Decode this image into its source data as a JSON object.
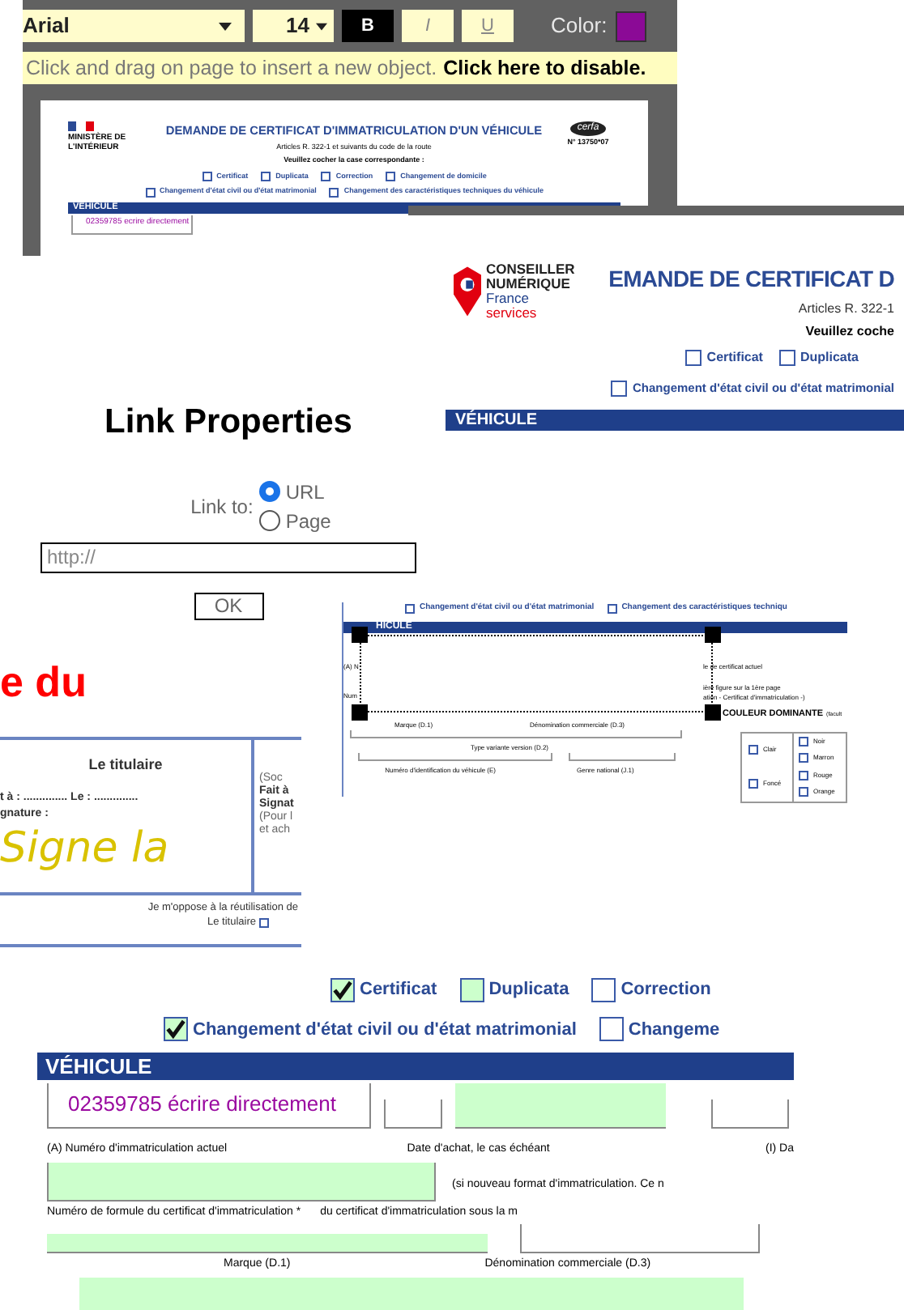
{
  "toolbar": {
    "font": "Arial",
    "size": "14",
    "styles": [
      {
        "label": "B",
        "kind": "bold",
        "selected": true
      },
      {
        "label": "I",
        "kind": "italic",
        "selected": false
      },
      {
        "label": "U",
        "kind": "underline",
        "selected": false
      }
    ],
    "color_label": "Color:",
    "color": "#8b0a96"
  },
  "hint": {
    "text": "Click and drag on page to insert a new object.",
    "link": "Click here to disable."
  },
  "preview_1": {
    "ministry": "MINISTÈRE DE L'INTÉRIEUR",
    "title": "DEMANDE DE CERTIFICAT D'IMMATRICULATION D'UN VÉHICULE",
    "cerfa": "cerfa",
    "cerfa_number": "N° 13750*07",
    "articles": "Articles R. 322-1 et suivants du code de la route",
    "instruction": "Veuillez cocher la case correspondante :",
    "options_row_1": [
      {
        "label": "Certificat",
        "checked": false
      },
      {
        "label": "Duplicata",
        "checked": false
      },
      {
        "label": "Correction",
        "checked": false
      },
      {
        "label": "Changement de domicile",
        "checked": false
      }
    ],
    "options_row_2": [
      {
        "label": "Changement d'état civil ou d'état matrimonial",
        "checked": false
      },
      {
        "label": "Changement des caractéristiques techniques du véhicule",
        "checked": false
      }
    ],
    "section": "VÉHICULE",
    "typed": "02359785 ecrire directement"
  },
  "preview_2": {
    "logo": [
      "CONSEILLER",
      "NUMÉRIQUE",
      "France",
      "services"
    ],
    "title": "EMANDE DE CERTIFICAT D",
    "articles": "Articles R. 322-1",
    "instruction": "Veuillez coche",
    "options_row_1": [
      {
        "label": "Certificat",
        "checked": false
      },
      {
        "label": "Duplicata",
        "checked": false
      }
    ],
    "options_row_2": [
      {
        "label": "Changement d'état civil ou d'état matrimonial",
        "checked": false
      }
    ],
    "section": "VÉHICULE"
  },
  "link_dialog": {
    "title": "Link Properties",
    "label": "Link to:",
    "options": [
      {
        "label": "URL",
        "selected": true
      },
      {
        "label": "Page",
        "selected": false
      }
    ],
    "placeholder": "http://",
    "ok": "OK"
  },
  "red_fragment": "e du",
  "signature": {
    "heading": "Le titulaire",
    "place_line": "t à : .............. Le : ..............",
    "signature_label": "gnature :",
    "signature": "Signe la",
    "side_lines": [
      "(Soc",
      "Fait à",
      "Signat",
      "(Pour l",
      "et ach"
    ],
    "objection": "Je m'oppose à la réutilisation de",
    "objection_by": "Le titulaire",
    "objection_checked": false
  },
  "preview_3": {
    "options": [
      {
        "label": "Changement d'état civil ou d'état matrimonial",
        "checked": false
      },
      {
        "label": "Changement des caractéristiques techniqu",
        "checked": false
      }
    ],
    "section": "HICULE",
    "left_labels": [
      "(A) N",
      "Num"
    ],
    "right_labels": [
      "le de certificat actuel",
      "ière figure sur la 1ère page",
      "ation - Certificat d'immatriculation -)"
    ],
    "color_heading": "COULEUR DOMINANTE",
    "color_note": "(facult",
    "marque": "Marque (D.1)",
    "denomination": "Dénomination commerciale (D.3)",
    "type": "Type variante version (D.2)",
    "vin": "Numéro d'identification du véhicule (E)",
    "genre": "Genre national (J.1)",
    "shades": [
      {
        "label": "Clair",
        "checked": false
      },
      {
        "label": "Foncé",
        "checked": false
      }
    ],
    "colors": [
      {
        "label": "Noir",
        "checked": false
      },
      {
        "label": "Marron",
        "checked": false
      },
      {
        "label": "Rouge",
        "checked": false
      },
      {
        "label": "Orange",
        "checked": false
      }
    ]
  },
  "preview_4": {
    "options_row_1": [
      {
        "label": "Certificat",
        "checked": true,
        "highlighted": true
      },
      {
        "label": "Duplicata",
        "checked": false,
        "highlighted": true
      },
      {
        "label": "Correction",
        "checked": false,
        "highlighted": false
      }
    ],
    "options_row_2": [
      {
        "label": "Changement d'état civil ou d'état matrimonial",
        "checked": true,
        "highlighted": true
      },
      {
        "label": "Changeme",
        "checked": false,
        "highlighted": false
      }
    ],
    "section": "VÉHICULE",
    "typed": "02359785 écrire directement",
    "plate_label": "(A) Numéro d'immatriculation actuel",
    "date_label": "Date d'achat, le cas échéant",
    "i_label": "(I) Da",
    "note_1": "(si nouveau format d'immatriculation. Ce n",
    "formula_label": "Numéro de formule du certificat d'immatriculation *",
    "note_2": "du certificat d'immatriculation sous la m",
    "marque": "Marque (D.1)",
    "denomination": "Dénomination commerciale (D.3)"
  }
}
